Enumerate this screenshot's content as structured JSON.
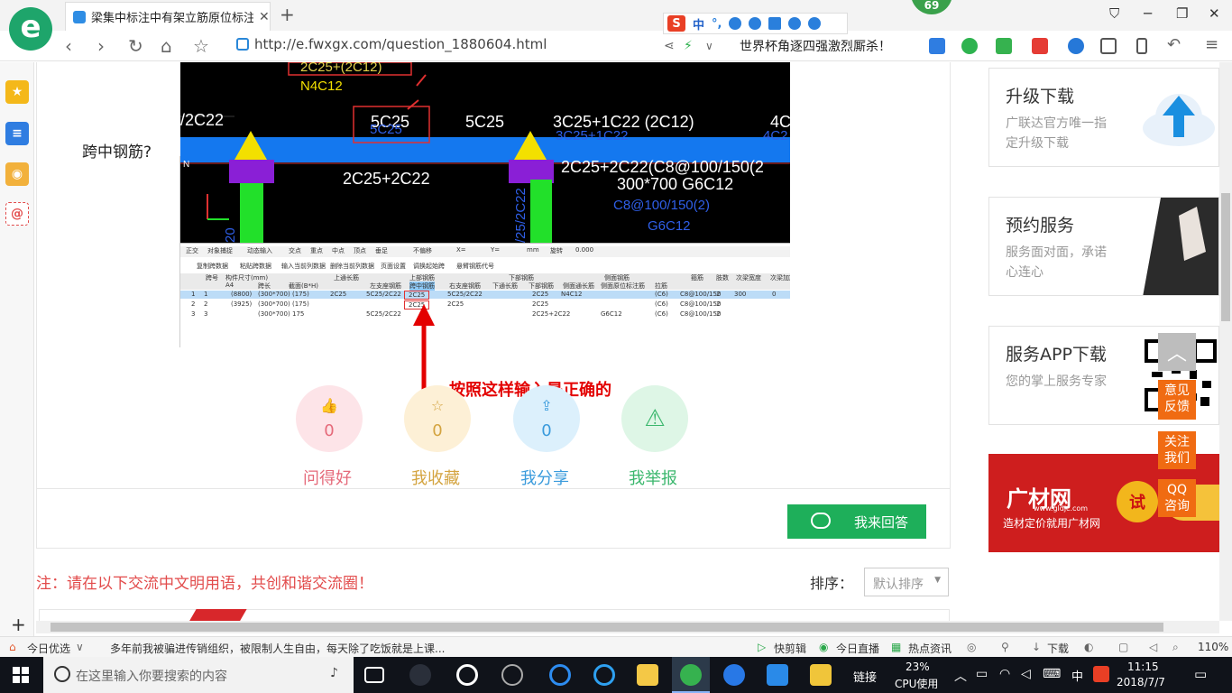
{
  "browser": {
    "tab_title": "梁集中标注中有架立筋原位标注中",
    "new_tab": "+",
    "badge": "69",
    "url": "http://e.fwxgx.com/question_1880604.html",
    "news_ticker": "世界杯角逐四强激烈厮杀！",
    "ime": {
      "s": "S",
      "label": "中"
    }
  },
  "question": {
    "label": "跨中钢筋?"
  },
  "cad_texts": {
    "t1": "2C25+(2C12)",
    "t2": "N4C12",
    "t3": "/2C22",
    "t4": "5C25",
    "t5": "5C25",
    "t6": "3C25+1C22 (2C12)",
    "t7": "4C",
    "t8": "5C25",
    "t9": "3C25+1C22",
    "t10": "4C2",
    "t11": "2C25+2C22",
    "t12": "2C25+2C22(C8@100/150(2",
    "t13": "300*700 G6C12",
    "t14": "C8@100/150(2)",
    "t15": "G6C12",
    "t16": "/25/2C22",
    "t17": "20",
    "t18": "N"
  },
  "table": {
    "toolbar": [
      "正交",
      "对象捕捉",
      "动态输入",
      "交点",
      "重点",
      "中点",
      "顶点",
      "垂足",
      "不偏移",
      "X=",
      "Y=",
      "mm",
      "旋转",
      "0.000"
    ],
    "toolbar2": [
      "复制跨数据",
      "粘贴跨数据",
      "输入当前列数据",
      "删除当前列数据",
      "页面设置",
      "调换起始跨",
      "悬臂钢筋代号"
    ],
    "headers": [
      "跨号",
      "标高",
      "构件尺寸(mm)",
      "上通长筋",
      "上部钢筋",
      "下部钢筋",
      "侧面钢筋",
      "箍筋",
      "肢数",
      "次梁宽度",
      "次梁加筋"
    ],
    "subheaders": [
      "A4",
      "跨长",
      "截面(B*H)",
      "距左边线距离",
      "左支座钢筋",
      "跨中钢筋",
      "右支座钢筋",
      "下通长筋",
      "下部钢筋",
      "侧面通长筋",
      "侧面原位标注筋",
      "拉筋"
    ],
    "rows": [
      [
        "1",
        "1",
        "(8800)",
        "(300*700)",
        "(175)",
        "2C25",
        "5C25/2C22",
        "2C25",
        "5C25/2C22",
        "2C25",
        "N4C12",
        "(C6)",
        "C8@100/150",
        "2",
        "300",
        "0"
      ],
      [
        "2",
        "2",
        "(3925)",
        "(300*700)",
        "(175)",
        "",
        "",
        "2C25",
        "",
        "2C25",
        "",
        "(C6)",
        "C8@100/150",
        "2",
        "",
        ""
      ],
      [
        "3",
        "3",
        "",
        "(300*700)",
        "175",
        "",
        "5C25/2C22",
        "",
        "2C25+2C22",
        "",
        "G6C12",
        "(C6)",
        "C8@100/150",
        "2",
        "",
        ""
      ]
    ]
  },
  "annotation": "按照这样输入是正确的",
  "actions": [
    {
      "icon": "👍",
      "count": "0",
      "label": "问得好",
      "color": "#e56a7a",
      "bg": "#fde4e8"
    },
    {
      "icon": "☆",
      "count": "0",
      "label": "我收藏",
      "color": "#d4a440",
      "bg": "#fdf0d6"
    },
    {
      "icon": "⇪",
      "count": "0",
      "label": "我分享",
      "color": "#3a9bdc",
      "bg": "#dcf0fc"
    },
    {
      "icon": "⚠",
      "count": "",
      "label": "我举报",
      "color": "#3bb76d",
      "bg": "#def6e6"
    }
  ],
  "reply_button": "我来回答",
  "notice": "注：请在以下交流中文明用语，共创和谐交流圈！",
  "sort": {
    "label": "排序：",
    "value": "默认排序"
  },
  "right": {
    "cards": [
      {
        "title": "升级下载",
        "desc": "广联达官方唯一指定升级下载"
      },
      {
        "title": "预约服务",
        "desc": "服务面对面，承诺心连心"
      },
      {
        "title": "服务APP下载",
        "desc": "您的掌上服务专家"
      }
    ],
    "ad": {
      "brand": "广材网",
      "url": "www.gldjc.com",
      "slogan": "造材定价就用广材网",
      "try": "试"
    },
    "float": [
      "意见\n反馈",
      "关注\n我们",
      "QQ\n咨询"
    ]
  },
  "statusbar": {
    "left": "今日优选",
    "headline": "多年前我被骗进传销组织，被限制人生自由，每天除了吃饭就是上课...",
    "items": [
      "快剪辑",
      "今日直播",
      "热点资讯",
      "下载"
    ],
    "zoom": "110%"
  },
  "taskbar": {
    "search_placeholder": "在这里输入你要搜索的内容",
    "link": "链接",
    "cpu_pct": "23%",
    "cpu_label": "CPU使用",
    "ime": "中",
    "time": "11:15",
    "date": "2018/7/7"
  },
  "colors": {
    "accent": "#1eaf5a",
    "annot": "#e30000",
    "cad_bg": "#000000"
  }
}
